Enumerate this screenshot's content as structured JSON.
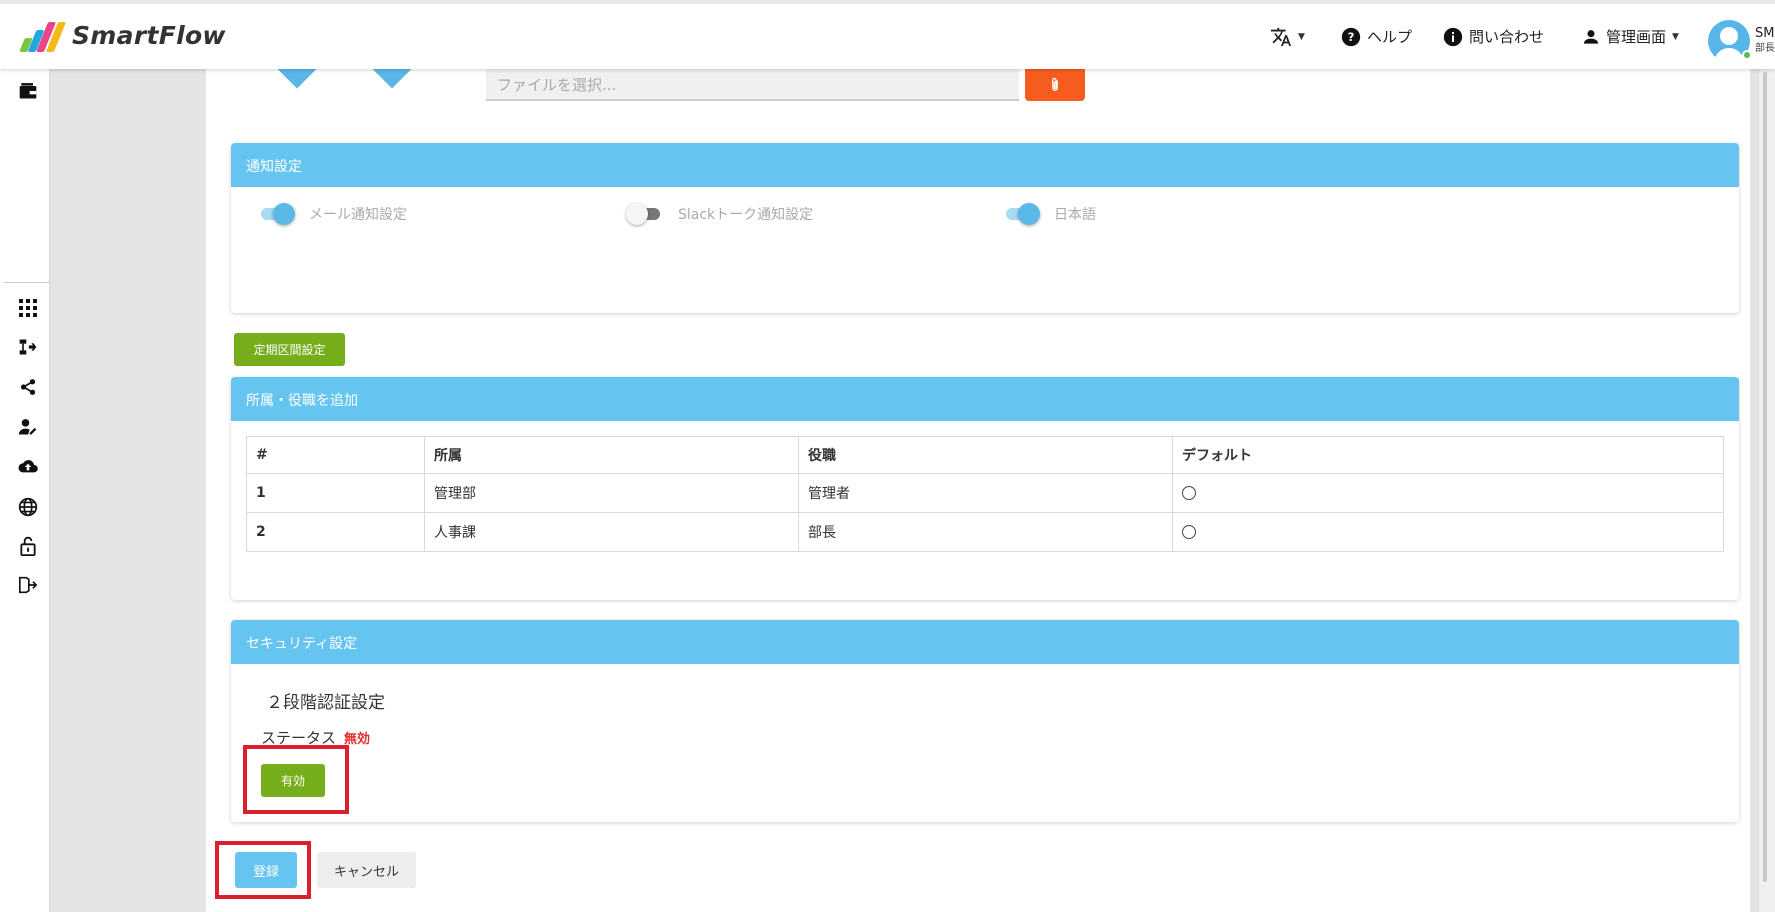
{
  "app": {
    "name": "SmartFlow"
  },
  "header": {
    "translate_icon": "translate-icon",
    "help_label": "ヘルプ",
    "contact_label": "問い合わせ",
    "admin_label": "管理画面",
    "user_name": "SM",
    "user_role": "部長"
  },
  "file": {
    "placeholder": "ファイルを選択..."
  },
  "notification": {
    "title": "通知設定",
    "toggles": [
      {
        "label": "メール通知設定",
        "on": true
      },
      {
        "label": "Slackトーク通知設定",
        "on": false
      },
      {
        "label": "日本語",
        "on": true
      }
    ]
  },
  "periodic_button": "定期区間設定",
  "affiliation": {
    "title": "所属・役職を追加",
    "columns": [
      "#",
      "所属",
      "役職",
      "デフォルト"
    ],
    "rows": [
      {
        "no": "1",
        "dept": "管理部",
        "position": "管理者"
      },
      {
        "no": "2",
        "dept": "人事課",
        "position": "部長"
      }
    ]
  },
  "security": {
    "title": "セキュリティ設定",
    "twofa_title": "２段階認証設定",
    "status_label": "ステータス",
    "status_value": "無効",
    "enable_button": "有効"
  },
  "footer": {
    "register": "登録",
    "cancel": "キャンセル"
  },
  "colors": {
    "accent": "#66c5f0",
    "green": "#76ad1b",
    "orange": "#f55c1e",
    "red": "#d9202c",
    "status_red": "#e62c2c"
  }
}
